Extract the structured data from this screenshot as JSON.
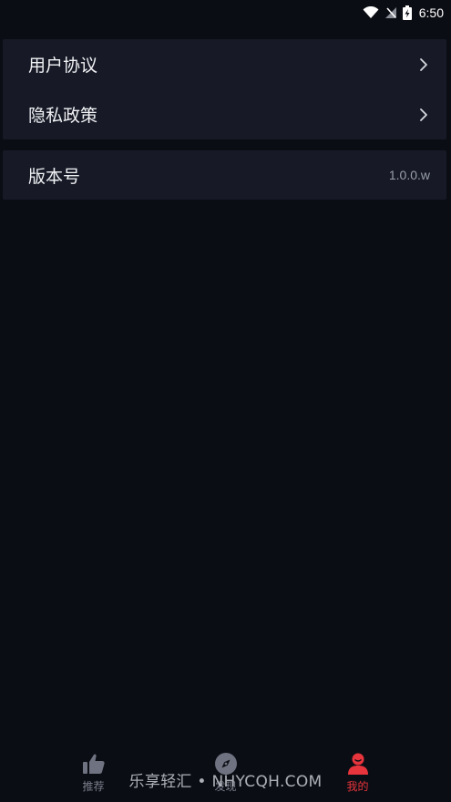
{
  "status_bar": {
    "time": "6:50",
    "icons": [
      "wifi-icon",
      "no-signal-icon",
      "battery-charging-icon"
    ]
  },
  "settings": {
    "group1": [
      {
        "label": "用户协议",
        "icon": "chevron-right-icon"
      },
      {
        "label": "隐私政策",
        "icon": "chevron-right-icon"
      }
    ],
    "group2": [
      {
        "label": "版本号",
        "value": "1.0.0.w"
      }
    ]
  },
  "bottom_nav": {
    "items": [
      {
        "label": "推荐",
        "icon": "thumbs-up-icon",
        "active": false
      },
      {
        "label": "发现",
        "icon": "compass-icon",
        "active": false
      },
      {
        "label": "我的",
        "icon": "user-icon",
        "active": true
      }
    ]
  },
  "watermark": "乐享轻汇 • NHYCQH.COM",
  "colors": {
    "background": "#0b0d14",
    "card": "#171a26",
    "accent": "#e8343c",
    "inactive": "#7c7f8c"
  }
}
